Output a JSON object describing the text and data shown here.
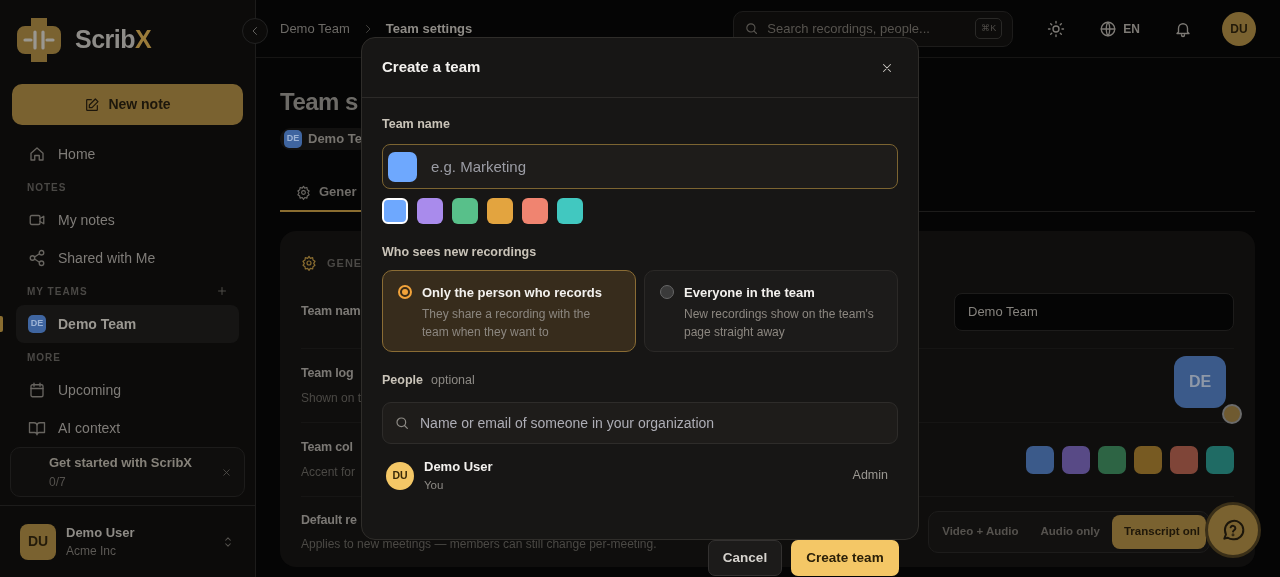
{
  "sidebar": {
    "logo": {
      "text": "Scrib",
      "accent": "X"
    },
    "new_note": "New note",
    "items": [
      {
        "kind": "link",
        "label": "Home",
        "selected": false
      },
      {
        "kind": "header",
        "label": "NOTES"
      },
      {
        "kind": "link",
        "label": "My notes",
        "selected": false
      },
      {
        "kind": "link",
        "label": "Shared with Me",
        "selected": false
      },
      {
        "kind": "header",
        "label": "MY TEAMS",
        "addable": true
      },
      {
        "kind": "team",
        "initials": "DE",
        "label": "Demo Team",
        "selected": true
      },
      {
        "kind": "header",
        "label": "MORE"
      },
      {
        "kind": "link",
        "label": "Upcoming",
        "selected": false
      },
      {
        "kind": "link",
        "label": "AI context",
        "selected": false
      }
    ],
    "get_started": {
      "title": "Get started with ScribX",
      "progress": "0/7"
    },
    "user": {
      "initials": "DU",
      "name": "Demo User",
      "org": "Acme Inc"
    }
  },
  "topbar": {
    "breadcrumb": [
      "Demo Team",
      "Team settings"
    ],
    "search": {
      "placeholder": "Search recordings, people...",
      "shortcut": "⌘K"
    },
    "language": "EN",
    "avatar": "DU"
  },
  "page": {
    "title": "Team s",
    "team_chip": {
      "initials": "DE",
      "label": "Demo Te"
    },
    "tabs": [
      {
        "label": "Gener",
        "selected": true
      }
    ],
    "section_title": "GENE",
    "rows": [
      {
        "kind": "input",
        "label": "Team nam",
        "value": "Demo Team"
      },
      {
        "kind": "logo",
        "label": "Team log",
        "description": "Shown on t",
        "initials": "DE"
      },
      {
        "kind": "colors",
        "label": "Team col",
        "description": "Accent for",
        "swatches": [
          {
            "color": "#3b5a8a"
          },
          {
            "color": "#584a86"
          },
          {
            "color": "#2d6444"
          },
          {
            "color": "#775a22"
          },
          {
            "color": "#7f4538"
          },
          {
            "color": "#1f6b64"
          }
        ]
      },
      {
        "kind": "segmented",
        "label": "Default re",
        "description": "Applies to new meetings — members can still change per-meeting.",
        "options": [
          {
            "label": "Video + Audio",
            "selected": false
          },
          {
            "label": "Audio only",
            "selected": false
          },
          {
            "label": "Transcript onl",
            "selected": true
          }
        ]
      }
    ]
  },
  "modal": {
    "title": "Create a team",
    "name_label": "Team name",
    "name_placeholder": "e.g. Marketing",
    "colors": [
      {
        "color": "#6ea8fe",
        "selected": true
      },
      {
        "color": "#a98bec",
        "selected": false
      },
      {
        "color": "#58c08a",
        "selected": false
      },
      {
        "color": "#e3a43f",
        "selected": false
      },
      {
        "color": "#f08470",
        "selected": false
      },
      {
        "color": "#41c8c0",
        "selected": false
      }
    ],
    "visibility_label": "Who sees new recordings",
    "visibility_options": [
      {
        "title": "Only the person who records",
        "description": "They share a recording with the team when they want to",
        "selected": true
      },
      {
        "title": "Everyone in the team",
        "description": "New recordings show on the team's page straight away",
        "selected": false
      }
    ],
    "people_label": "People",
    "people_hint": "optional",
    "people_placeholder": "Name or email of someone in your organization",
    "members": [
      {
        "initials": "DU",
        "name": "Demo User",
        "note": "You",
        "role": "Admin"
      }
    ],
    "buttons": [
      {
        "label": "Cancel",
        "kind": "secondary"
      },
      {
        "label": "Create team",
        "kind": "primary"
      }
    ]
  }
}
